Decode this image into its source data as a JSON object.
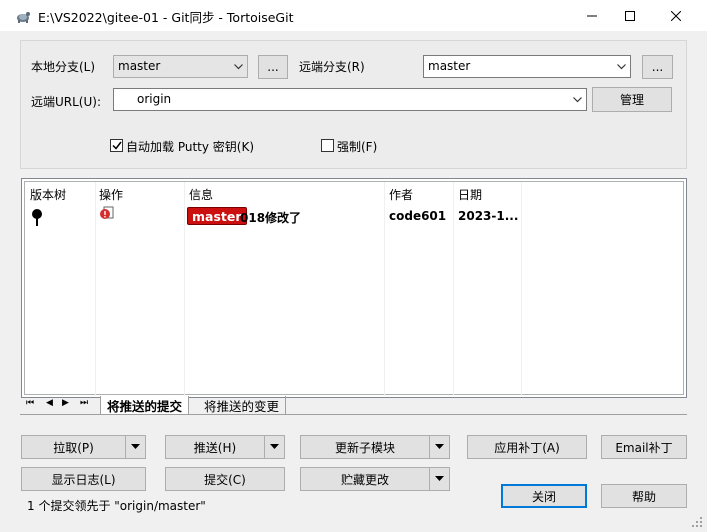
{
  "window": {
    "title": "E:\\VS2022\\gitee-01 - Git同步 - TortoiseGit"
  },
  "top": {
    "local_branch_label": "本地分支(L)",
    "local_branch_value": "master",
    "local_more": "...",
    "remote_branch_label": "远端分支(R)",
    "remote_branch_value": "master",
    "remote_more": "...",
    "remote_url_label": "远端URL(U):",
    "remote_url_value": "origin",
    "manage_label": "管理",
    "autoload_putty_label": "自动加载 Putty 密钥(K)",
    "autoload_putty_checked": true,
    "force_label": "强制(F)",
    "force_checked": false
  },
  "list": {
    "columns": [
      "版本树",
      "操作",
      "信息",
      "作者",
      "日期"
    ],
    "rows": [
      {
        "branch_tag": "master",
        "message": "018修改了",
        "author": "code601",
        "date": "2023-1..."
      }
    ]
  },
  "tabs": {
    "nav_first": "⏮",
    "nav_prev": "◀",
    "nav_next": "▶",
    "nav_last": "⏭",
    "items": [
      "将推送的提交",
      "将推送的变更"
    ],
    "active": 0
  },
  "buttons": {
    "pull": "拉取(P)",
    "push": "推送(H)",
    "update_submodules": "更新子模块",
    "apply_patch": "应用补丁(A)",
    "email_patch": "Email补丁",
    "show_log": "显示日志(L)",
    "commit": "提交(C)",
    "stash": "贮藏更改",
    "close": "关闭",
    "help": "帮助"
  },
  "status": {
    "text": "1 个提交领先于 \"origin/master\""
  },
  "colors": {
    "branch_tag_bg": "#cc1010",
    "accent": "#0078d7"
  }
}
